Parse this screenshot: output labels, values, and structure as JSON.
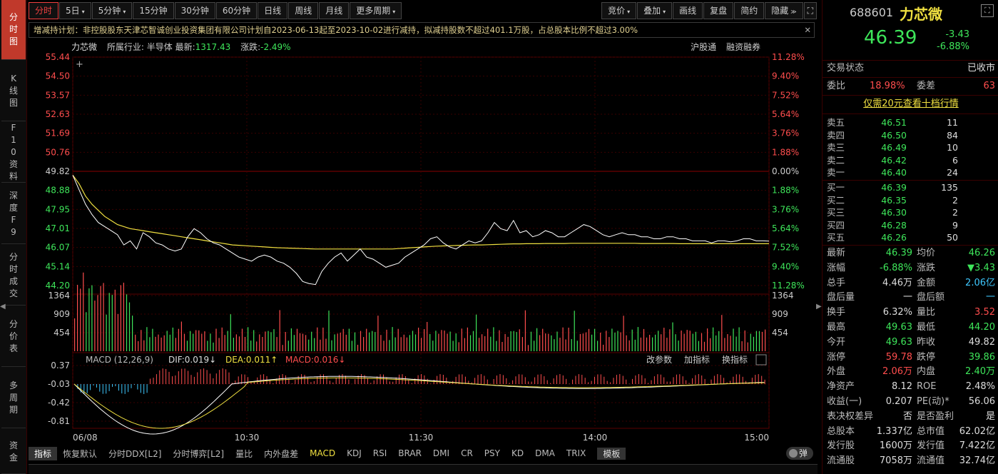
{
  "left_nav": [
    {
      "label": "分时图",
      "active": true
    },
    {
      "label": "K线图",
      "active": false
    },
    {
      "label": "F10资料",
      "active": false
    },
    {
      "label": "深度F9",
      "active": false
    },
    {
      "label": "分时成交",
      "active": false
    },
    {
      "label": "分价表",
      "active": false
    },
    {
      "label": "多周期",
      "active": false
    },
    {
      "label": "资金",
      "active": false
    }
  ],
  "toolbar": {
    "periods": [
      "分时",
      "5日",
      "5分钟",
      "15分钟",
      "30分钟",
      "60分钟",
      "日线",
      "周线",
      "月线",
      "更多周期"
    ],
    "right": [
      "竞价",
      "叠加",
      "画线",
      "复盘",
      "简约",
      "隐藏"
    ]
  },
  "notice": {
    "text": "增减持计划：非控股股东天津芯智诚创业投资集团有限公司计划自2023-06-13起至2023-10-02进行减持，拟减持股数不超过401.1万股，占总股本比例不超过3.00%",
    "close": "✕"
  },
  "info": {
    "name": "力芯微",
    "industry_label": "所属行业:",
    "industry": "半导体",
    "latest_label": "最新:",
    "latest": "1317.43",
    "change_label": "涨跌:",
    "change": "-2.49%",
    "right1": "沪股通",
    "right2": "融资融券"
  },
  "price_axis_left": [
    "55.44",
    "54.50",
    "53.57",
    "52.63",
    "51.69",
    "50.76",
    "49.82",
    "48.88",
    "47.95",
    "47.01",
    "46.07",
    "45.14",
    "44.20"
  ],
  "price_axis_right": [
    "11.28%",
    "9.40%",
    "7.52%",
    "5.64%",
    "3.76%",
    "1.88%",
    "0.00%",
    "1.88%",
    "3.76%",
    "5.64%",
    "7.52%",
    "9.40%",
    "11.28%"
  ],
  "volume_axis": [
    "1364",
    "909",
    "454"
  ],
  "macd_header": {
    "title": "MACD (12,26,9)",
    "dif": "DIF:0.019↓",
    "dea": "DEA:0.011↑",
    "macd": "MACD:0.016↓",
    "actions": [
      "改参数",
      "加指标",
      "换指标"
    ]
  },
  "macd_axis": [
    "0.37",
    "-0.03",
    "-0.42",
    "-0.81"
  ],
  "time_axis": [
    "06/08",
    "10:30",
    "11:30",
    "14:00",
    "15:00"
  ],
  "bottom_tabs": [
    "指标",
    "恢复默认",
    "分时DDX[L2]",
    "分时博弈[L2]",
    "量比",
    "内外盘差",
    "MACD",
    "KDJ",
    "RSI",
    "BRAR",
    "DMI",
    "CR",
    "PSY",
    "KD",
    "DMA",
    "TRIX"
  ],
  "template_label": "模板",
  "toggle_label": "弹",
  "colors": {
    "up": "#ff4d4d",
    "down": "#3ee65a",
    "price_line": "#ffffff",
    "avg_line": "#f0e040",
    "macd_neg": "#3ec8ff"
  },
  "quote": {
    "code": "688601",
    "name": "力芯微",
    "price": "46.39",
    "change": "-3.43",
    "change_pct": "-6.88%",
    "status_label": "交易状态",
    "status": "已收市",
    "weibi_label": "委比",
    "weibi": "18.98%",
    "weicha_label": "委差",
    "weicha": "63",
    "promo": "仅需20元查看十档行情"
  },
  "sell_orders": [
    {
      "label": "卖五",
      "price": "46.51",
      "vol": "11"
    },
    {
      "label": "卖四",
      "price": "46.50",
      "vol": "84"
    },
    {
      "label": "卖三",
      "price": "46.49",
      "vol": "10"
    },
    {
      "label": "卖二",
      "price": "46.42",
      "vol": "6"
    },
    {
      "label": "卖一",
      "price": "46.40",
      "vol": "24"
    }
  ],
  "buy_orders": [
    {
      "label": "买一",
      "price": "46.39",
      "vol": "135"
    },
    {
      "label": "买二",
      "price": "46.35",
      "vol": "2"
    },
    {
      "label": "买三",
      "price": "46.30",
      "vol": "2"
    },
    {
      "label": "买四",
      "price": "46.28",
      "vol": "9"
    },
    {
      "label": "买五",
      "price": "46.26",
      "vol": "50"
    }
  ],
  "stats": [
    {
      "l1": "最新",
      "v1": "46.39",
      "c1": "green",
      "l2": "均价",
      "v2": "46.26",
      "c2": "green"
    },
    {
      "l1": "涨幅",
      "v1": "-6.88%",
      "c1": "green",
      "l2": "涨跌",
      "v2": "▼3.43",
      "c2": "green"
    },
    {
      "l1": "总手",
      "v1": "4.46万",
      "c1": "white",
      "l2": "金额",
      "v2": "2.06亿",
      "c2": "cyan"
    },
    {
      "l1": "盘后量",
      "v1": "一",
      "c1": "white",
      "l2": "盘后额",
      "v2": "一",
      "c2": "cyan"
    },
    {
      "l1": "换手",
      "v1": "6.32%",
      "c1": "white",
      "l2": "量比",
      "v2": "3.52",
      "c2": "red"
    },
    {
      "l1": "最高",
      "v1": "49.63",
      "c1": "green",
      "l2": "最低",
      "v2": "44.20",
      "c2": "green"
    },
    {
      "l1": "今开",
      "v1": "49.63",
      "c1": "green",
      "l2": "昨收",
      "v2": "49.82",
      "c2": "white"
    },
    {
      "l1": "涨停",
      "v1": "59.78",
      "c1": "red",
      "l2": "跌停",
      "v2": "39.86",
      "c2": "green"
    },
    {
      "l1": "外盘",
      "v1": "2.06万",
      "c1": "red",
      "l2": "内盘",
      "v2": "2.40万",
      "c2": "green"
    },
    {
      "l1": "净资产",
      "v1": "8.12",
      "c1": "white",
      "l2": "ROE",
      "v2": "2.48%",
      "c2": "white"
    },
    {
      "l1": "收益(一)",
      "v1": "0.207",
      "c1": "white",
      "l2": "PE(动)*",
      "v2": "56.06",
      "c2": "white"
    },
    {
      "l1": "表决权差异",
      "v1": "否",
      "c1": "white",
      "l2": "是否盈利",
      "v2": "是",
      "c2": "white"
    },
    {
      "l1": "总股本",
      "v1": "1.337亿",
      "c1": "white",
      "l2": "总市值",
      "v2": "62.02亿",
      "c2": "white"
    },
    {
      "l1": "发行股",
      "v1": "1600万",
      "c1": "white",
      "l2": "发行值",
      "v2": "7.422亿",
      "c2": "white"
    },
    {
      "l1": "流通股",
      "v1": "7058万",
      "c1": "white",
      "l2": "流通值",
      "v2": "32.74亿",
      "c2": "white"
    }
  ],
  "chart_data": {
    "type": "line",
    "y_range": [
      44.2,
      55.44
    ],
    "prev_close": 49.82,
    "series": [],
    "price": [
      49.63,
      48.9,
      48.2,
      47.7,
      47.3,
      47.1,
      46.9,
      46.7,
      46.2,
      46.4,
      46.0,
      46.8,
      46.6,
      46.3,
      46.2,
      46.0,
      45.9,
      46.0,
      46.6,
      47.0,
      46.8,
      46.5,
      46.3,
      46.2,
      46.0,
      45.8,
      45.6,
      45.5,
      45.4,
      45.6,
      45.7,
      45.6,
      45.4,
      45.3,
      45.1,
      44.8,
      44.4,
      44.3,
      44.25,
      44.9,
      45.3,
      45.6,
      45.8,
      45.4,
      45.7,
      46.0,
      45.6,
      45.5,
      45.3,
      45.1,
      45.2,
      45.3,
      45.6,
      45.8,
      46.0,
      46.2,
      46.5,
      46.6,
      46.3,
      46.1,
      46.0,
      46.2,
      46.4,
      46.3,
      46.4,
      46.8,
      47.3,
      47.0,
      46.9,
      47.4,
      46.8,
      46.9,
      46.6,
      46.7,
      46.9,
      46.8,
      46.6,
      46.6,
      46.8,
      47.0,
      47.2,
      47.1,
      46.9,
      46.7,
      46.6,
      46.7,
      46.8,
      46.7,
      46.7,
      46.6,
      46.6,
      46.5,
      46.5,
      46.6,
      46.6,
      46.5,
      46.5,
      46.4,
      46.4,
      46.4,
      46.3,
      46.4,
      46.4,
      46.35,
      46.4,
      46.5,
      46.5,
      46.4,
      46.4,
      46.39
    ],
    "avg": [
      49.63,
      49.2,
      48.6,
      48.2,
      47.9,
      47.6,
      47.4,
      47.2,
      47.1,
      47.0,
      46.95,
      46.9,
      46.85,
      46.8,
      46.75,
      46.7,
      46.65,
      46.6,
      46.55,
      46.5,
      46.45,
      46.4,
      46.35,
      46.3,
      46.25,
      46.2,
      46.18,
      46.16,
      46.14,
      46.12,
      46.1,
      46.08,
      46.06,
      46.05,
      46.04,
      46.03,
      46.02,
      46.01,
      46.0,
      46.0,
      46.0,
      46.0,
      46.0,
      46.0,
      46.0,
      46.0,
      46.0,
      46.0,
      46.0,
      46.0,
      46.0,
      46.02,
      46.04,
      46.06,
      46.08,
      46.1,
      46.12,
      46.14,
      46.15,
      46.16,
      46.17,
      46.18,
      46.19,
      46.2,
      46.2,
      46.21,
      46.22,
      46.23,
      46.24,
      46.25,
      46.25,
      46.26,
      46.26,
      46.26,
      46.27,
      46.27,
      46.27,
      46.27,
      46.28,
      46.28,
      46.28,
      46.28,
      46.28,
      46.28,
      46.28,
      46.28,
      46.28,
      46.28,
      46.28,
      46.27,
      46.27,
      46.27,
      46.27,
      46.27,
      46.27,
      46.26,
      46.26,
      46.26,
      46.26,
      46.26,
      46.26,
      46.26,
      46.26,
      46.26,
      46.26,
      46.26,
      46.26,
      46.26,
      46.26,
      46.26
    ]
  }
}
